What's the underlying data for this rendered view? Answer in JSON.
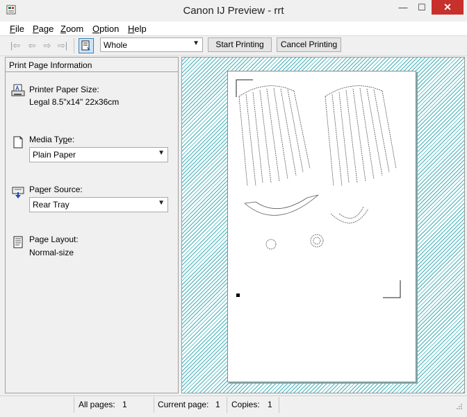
{
  "window": {
    "title": "Canon IJ Preview - rrt",
    "minimize_glyph": "—",
    "maximize_glyph": "☐",
    "close_glyph": "✕"
  },
  "menu": {
    "items": [
      {
        "key": "F",
        "rest": "ile"
      },
      {
        "key": "P",
        "rest": "age"
      },
      {
        "key": "Z",
        "rest": "oom"
      },
      {
        "key": "O",
        "rest": "ption"
      },
      {
        "key": "H",
        "rest": "elp"
      }
    ]
  },
  "toolbar": {
    "first_glyph": "|⇦",
    "prev_glyph": "⇦",
    "next_glyph": "⇨",
    "last_glyph": "⇨|",
    "zoom_value": "Whole",
    "start_printing": "Start Printing",
    "cancel_printing": "Cancel Printing"
  },
  "panel": {
    "header": "Print Page Information",
    "paper_size_label": "Printer Paper Size:",
    "paper_size_value": "Legal 8.5\"x14\" 22x36cm",
    "media_type_label_pre": "Media Ty",
    "media_type_label_key": "p",
    "media_type_label_post": "e:",
    "media_type_value": "Plain Paper",
    "paper_source_label_pre": "Pa",
    "paper_source_label_key": "p",
    "paper_source_label_post": "er Source:",
    "paper_source_value": "Rear Tray",
    "page_layout_label": "Page Layout:",
    "page_layout_value": "Normal-size"
  },
  "status": {
    "all_pages_label": "All pages:",
    "all_pages_value": "1",
    "current_page_label": "Current page:",
    "current_page_value": "1",
    "copies_label": "Copies:",
    "copies_value": "1"
  },
  "colors": {
    "close_button": "#c7302b",
    "preview_hatch": "#3fb0b8",
    "selected_tool": "#cde4f7"
  }
}
